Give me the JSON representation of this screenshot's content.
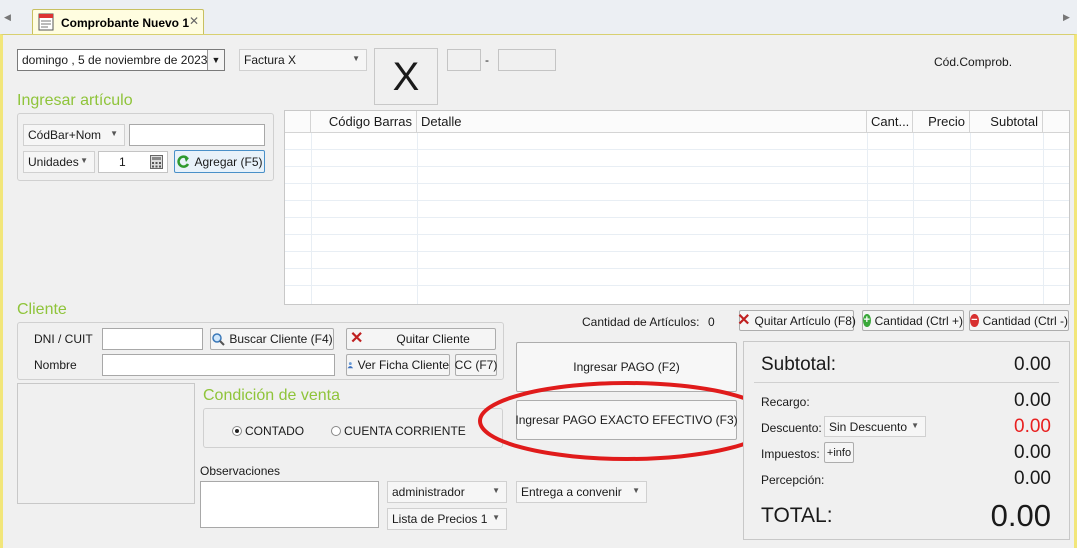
{
  "tabs": [
    {
      "label": "Comprobante Nuevo 1",
      "close_glyph": "✕"
    }
  ],
  "header": {
    "date_value": "domingo ,   5 de noviembre  de 2023",
    "doc_type": "Factura X",
    "letter": "X",
    "number_separator": "-",
    "cod_comprob_label": "Cód.Comprob."
  },
  "ingresar": {
    "title": "Ingresar artículo",
    "search_mode": "CódBar+Nom",
    "unit": "Unidades",
    "quantity": "1",
    "agregar_label": "Agregar (F5)"
  },
  "grid": {
    "columns": [
      "",
      "Código Barras",
      "Detalle",
      "Cant...",
      "Precio",
      "Subtotal",
      ""
    ]
  },
  "items": {
    "count_label": "Cantidad de Artículos:",
    "count_value": "0",
    "quitar_label": "Quitar Artículo (F8)",
    "cant_plus_label": "Cantidad (Ctrl +)",
    "cant_minus_label": "Cantidad (Ctrl -)"
  },
  "cliente": {
    "title": "Cliente",
    "dni_label": "DNI / CUIT",
    "nombre_label": "Nombre",
    "buscar_label": "Buscar Cliente (F4)",
    "quitar_label": "Quitar Cliente",
    "ficha_label": "Ver Ficha Cliente",
    "cc_label": "CC (F7)"
  },
  "condicion": {
    "title": "Condición de venta",
    "option_contado": "CONTADO",
    "option_cc": "CUENTA CORRIENTE",
    "selected": "CONTADO"
  },
  "observaciones": {
    "label": "Observaciones",
    "vendedor": "administrador",
    "lista": "Lista de Precios 1",
    "entrega": "Entrega a convenir"
  },
  "pago": {
    "ingresar_label": "Ingresar PAGO (F2)",
    "exacto_label": "Ingresar PAGO EXACTO EFECTIVO (F3)"
  },
  "totals": {
    "subtotal_label": "Subtotal:",
    "subtotal_value": "0.00",
    "recargo_label": "Recargo:",
    "recargo_value": "0.00",
    "descuento_label": "Descuento:",
    "descuento_select": "Sin Descuento",
    "descuento_value": "0.00",
    "impuestos_label": "Impuestos:",
    "info_label": "+info",
    "impuestos_value": "0.00",
    "percepcion_label": "Percepción:",
    "percepcion_value": "0.00",
    "total_label": "TOTAL:",
    "total_value": "0.00"
  },
  "colors": {
    "section_title": "#8fc43a",
    "highlight_ellipse": "#e01b1b",
    "descuento_value": "#e82020",
    "tab_background": "#fffde0"
  }
}
